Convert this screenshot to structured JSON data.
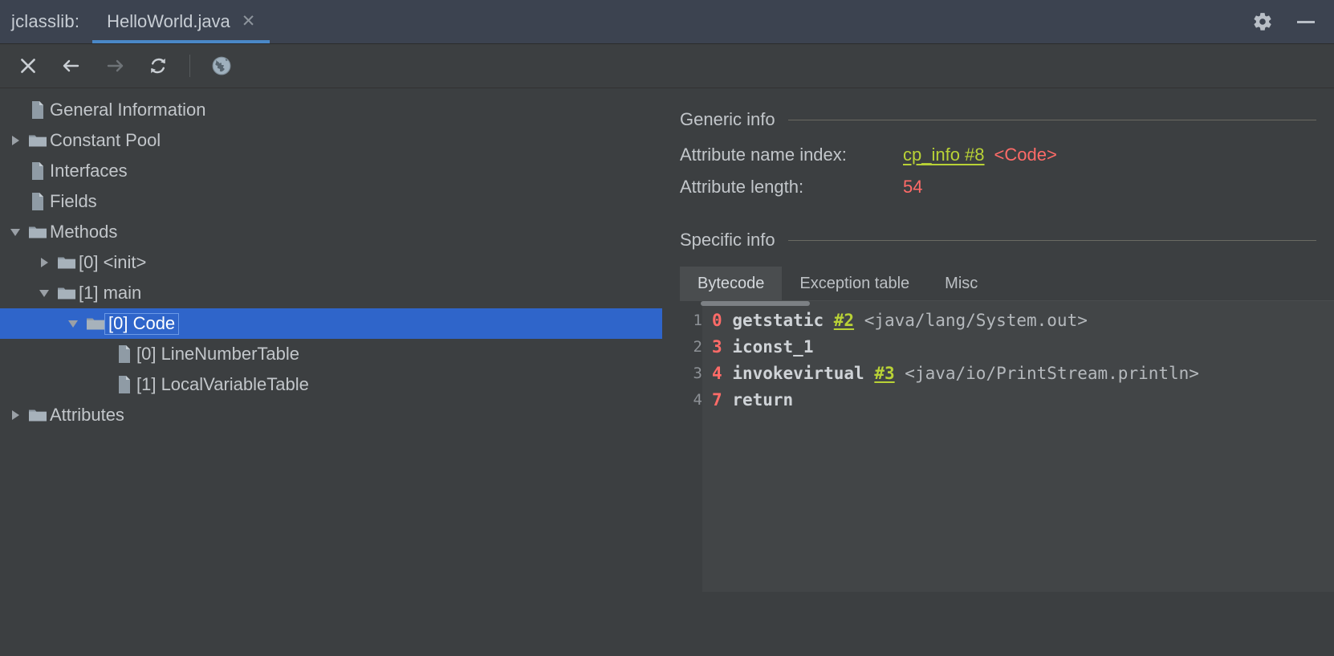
{
  "titlebar": {
    "tool_label": "jclasslib:",
    "file_tab": "HelloWorld.java",
    "close_glyph": "✕",
    "gear_icon": "gear-icon",
    "minimize_icon": "minimize-icon",
    "accent": "#4a88c7"
  },
  "toolbar": {
    "buttons": [
      {
        "name": "close-button",
        "glyph": "✕"
      },
      {
        "name": "back-button",
        "glyph": "←"
      },
      {
        "name": "forward-button",
        "glyph": "→"
      },
      {
        "name": "reload-button",
        "glyph": "↻"
      },
      {
        "name": "browse-web-button",
        "glyph": "ἱ0"
      }
    ]
  },
  "tree": {
    "items": [
      {
        "label": "General Information",
        "indent": 0,
        "twisty": "none",
        "icon": "file-icon",
        "selected": false
      },
      {
        "label": "Constant Pool",
        "indent": 0,
        "twisty": "collapsed",
        "icon": "folder-icon",
        "selected": false
      },
      {
        "label": "Interfaces",
        "indent": 0,
        "twisty": "none",
        "icon": "file-icon",
        "selected": false
      },
      {
        "label": "Fields",
        "indent": 0,
        "twisty": "none",
        "icon": "file-icon",
        "selected": false
      },
      {
        "label": "Methods",
        "indent": 0,
        "twisty": "expanded",
        "icon": "folder-icon",
        "selected": false
      },
      {
        "label": "[0] <init>",
        "indent": 1,
        "twisty": "collapsed",
        "icon": "folder-icon",
        "selected": false
      },
      {
        "label": "[1] main",
        "indent": 1,
        "twisty": "expanded",
        "icon": "folder-icon",
        "selected": false
      },
      {
        "label": "[0] Code",
        "indent": 2,
        "twisty": "expanded",
        "icon": "folder-icon",
        "selected": true
      },
      {
        "label": "[0] LineNumberTable",
        "indent": 3,
        "twisty": "none",
        "icon": "file-icon",
        "selected": false
      },
      {
        "label": "[1] LocalVariableTable",
        "indent": 3,
        "twisty": "none",
        "icon": "file-icon",
        "selected": false
      },
      {
        "label": "Attributes",
        "indent": 0,
        "twisty": "collapsed",
        "icon": "folder-icon",
        "selected": false
      }
    ],
    "selection_color": "#2f65ca"
  },
  "detail": {
    "generic_info": {
      "title": "Generic info",
      "rows": [
        {
          "key": "Attribute name index:",
          "link": "cp_info #8",
          "suffix": "<Code>"
        },
        {
          "key": "Attribute length:",
          "link": null,
          "suffix": "54"
        }
      ]
    },
    "specific_info": {
      "title": "Specific info",
      "tabs": [
        {
          "label": "Bytecode",
          "active": true
        },
        {
          "label": "Exception table",
          "active": false
        },
        {
          "label": "Misc",
          "active": false
        }
      ]
    },
    "bytecode": {
      "lines": [
        {
          "n": "1",
          "offset": "0",
          "op": "getstatic",
          "ref": "#2",
          "desc": "<java/lang/System.out>"
        },
        {
          "n": "2",
          "offset": "3",
          "op": "iconst_1",
          "ref": "",
          "desc": ""
        },
        {
          "n": "3",
          "offset": "4",
          "op": "invokevirtual",
          "ref": "#3",
          "desc": "<java/io/PrintStream.println>"
        },
        {
          "n": "4",
          "offset": "7",
          "op": "return",
          "ref": "",
          "desc": ""
        }
      ]
    },
    "colors": {
      "link": "#b9d236",
      "value": "#ff6b68",
      "text": "#c2c6ca"
    }
  }
}
